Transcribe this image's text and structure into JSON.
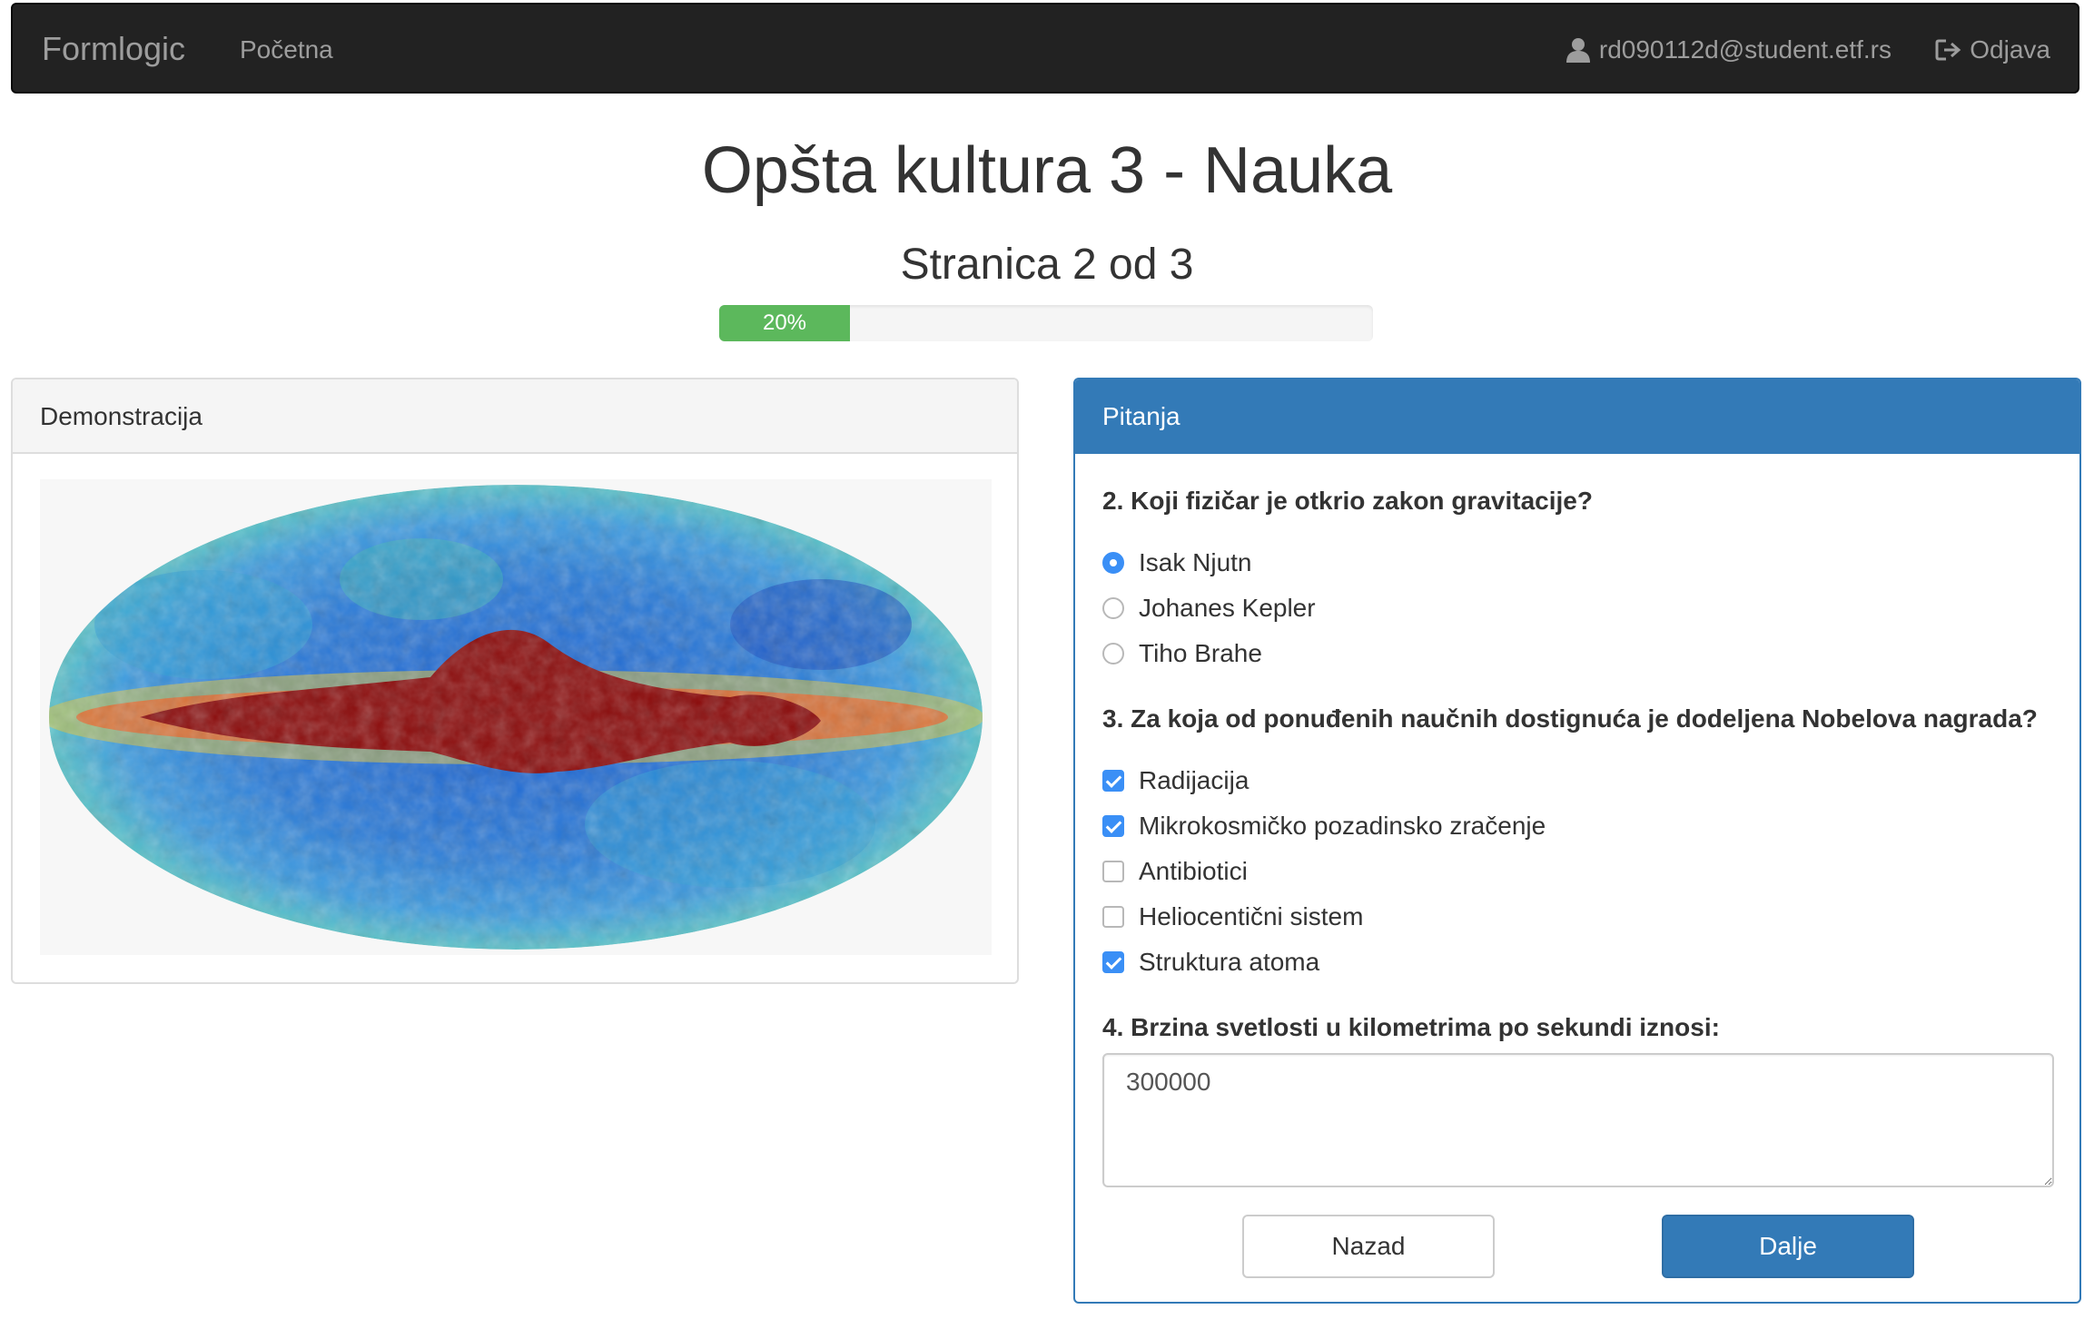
{
  "navbar": {
    "brand": "Formlogic",
    "home": "Početna",
    "user_email": "rd090112d@student.etf.rs",
    "logout": "Odjava"
  },
  "page": {
    "title": "Opšta kultura 3 - Nauka",
    "subtitle": "Stranica 2 od 3",
    "progress": {
      "value": 20,
      "label": "20%"
    }
  },
  "demo_panel": {
    "heading": "Demonstracija"
  },
  "questions_panel": {
    "heading": "Pitanja",
    "q2": {
      "title": "2. Koji fizičar je otkrio zakon gravitacije?",
      "options": [
        {
          "label": "Isak Njutn",
          "selected": true
        },
        {
          "label": "Johanes Kepler",
          "selected": false
        },
        {
          "label": "Tiho Brahe",
          "selected": false
        }
      ]
    },
    "q3": {
      "title": "3. Za koja od ponuđenih naučnih dostignuća je dodeljena Nobelova nagrada?",
      "options": [
        {
          "label": "Radijacija",
          "checked": true
        },
        {
          "label": "Mikrokosmičko pozadinsko zračenje",
          "checked": true
        },
        {
          "label": "Antibiotici",
          "checked": false
        },
        {
          "label": "Heliocentični sistem",
          "checked": false
        },
        {
          "label": "Struktura atoma",
          "checked": true
        }
      ]
    },
    "q4": {
      "title": "4. Brzina svetlosti u kilometrima po sekundi iznosi:",
      "answer": "300000"
    },
    "buttons": {
      "back": "Nazad",
      "next": "Dalje"
    }
  },
  "colors": {
    "primary": "#337ab7",
    "progress": "#5cb85c",
    "navbar": "#222222"
  }
}
